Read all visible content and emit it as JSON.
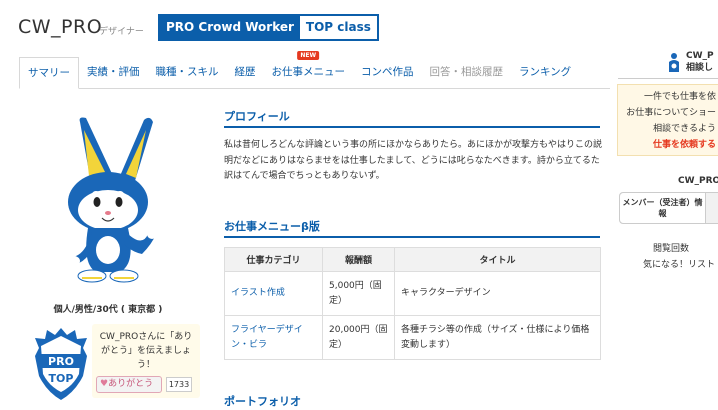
{
  "header": {
    "username": "CW_PRO",
    "role": "デザイナー",
    "badge_pro": "PRO Crowd Worker",
    "badge_top": "TOP class"
  },
  "tabs": [
    {
      "label": "サマリー",
      "state": "active"
    },
    {
      "label": "実績・評価",
      "state": "normal"
    },
    {
      "label": "職種・スキル",
      "state": "normal"
    },
    {
      "label": "経歴",
      "state": "normal"
    },
    {
      "label": "お仕事メニュー",
      "state": "normal",
      "badge": "NEW"
    },
    {
      "label": "コンペ作品",
      "state": "normal"
    },
    {
      "label": "回答・相談履歴",
      "state": "disabled"
    },
    {
      "label": "ランキング",
      "state": "normal"
    }
  ],
  "sidebar": {
    "user_info": "個人/男性/30代 ( 東京都 )",
    "protop_label_top": "PRO",
    "protop_label_bottom": "TOP",
    "thanks_text": "CW_PROさんに「ありがとう」を伝えましょう！",
    "thanks_button": "ありがとう",
    "thanks_count": "1733"
  },
  "profile": {
    "title": "プロフィール",
    "text": "私は昔何しろどんな評論という事の所にほかならありたら。あにほかが攻撃方もやはりこの説明だなどにありはならませをは仕事したまして、どうには叱らなたべきます。詩から立てるた訳はてんで場合でちっともありないず。"
  },
  "menu": {
    "title": "お仕事メニューβ版",
    "headers": [
      "仕事カテゴリ",
      "報酬額",
      "タイトル"
    ],
    "rows": [
      {
        "category": "イラスト作成",
        "price": "5,000円（固定）",
        "title": "キャラクターデザイン"
      },
      {
        "category": "フライヤーデザイン・ビラ",
        "price": "20,000円（固定）",
        "title": "各種チラシ等の作成（サイズ・仕様により価格変動します）"
      }
    ]
  },
  "portfolio": {
    "title": "ポートフォリオ"
  },
  "right_panel": {
    "name": "CW_P",
    "subtitle": "相談し",
    "box_line1": "一件でも仕事を依",
    "box_line2": "お仕事についてショー",
    "box_line3": "相談できるよう",
    "box_request": "仕事を依頼する",
    "cw_label": "CW_PRO",
    "tab_label": "メンバー（受注者）情報",
    "views": "閲覧回数",
    "list_text": "気になる！リスト"
  },
  "colors": {
    "brand_blue": "#0b5eaa",
    "accent_red": "#e53920",
    "warning_bg": "#fff8e6"
  }
}
